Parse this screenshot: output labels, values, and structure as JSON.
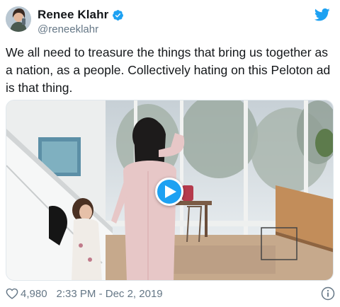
{
  "author": {
    "display_name": "Renee Klahr",
    "handle": "@reneeklahr",
    "verified": true
  },
  "tweet": {
    "text": "We all need to treasure the things that bring us together as a nation, as a people. Collectively hating on this Peloton ad is that thing."
  },
  "media": {
    "type": "video",
    "play_icon": "play-icon"
  },
  "footer": {
    "likes": "4,980",
    "timestamp": "2:33 PM - Dec 2, 2019"
  },
  "icons": {
    "brand": "twitter-bird-icon",
    "verified": "verified-badge-icon",
    "like": "heart-icon",
    "info": "info-icon"
  },
  "colors": {
    "brand_blue": "#1da1f2",
    "text": "#14171a",
    "secondary_text": "#657786"
  }
}
